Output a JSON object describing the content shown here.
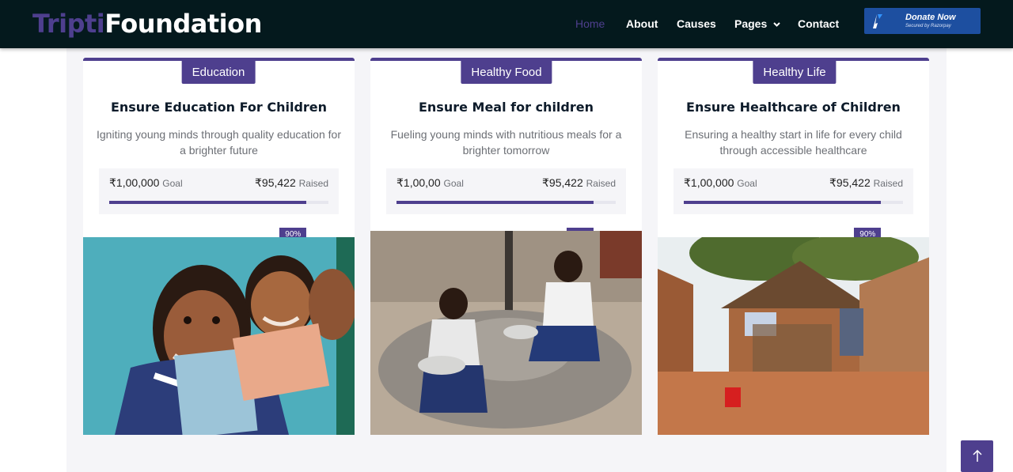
{
  "brand": {
    "part1": "Tripti",
    "part2": "Foundation"
  },
  "nav": {
    "items": [
      {
        "label": "Home",
        "active": true
      },
      {
        "label": "About",
        "active": false
      },
      {
        "label": "Causes",
        "active": false
      },
      {
        "label": "Pages",
        "active": false,
        "has_dropdown": true
      },
      {
        "label": "Contact",
        "active": false
      }
    ],
    "donate": {
      "label": "Donate Now",
      "sublabel": "Secured by Razorpay"
    }
  },
  "causes": [
    {
      "category": "Education",
      "title": "Ensure Education For Children",
      "description": "Igniting young minds through quality education for a brighter future",
      "goal_amount": "₹1,00,000",
      "goal_label": "Goal",
      "raised_amount": "₹95,422",
      "raised_label": "Raised",
      "progress_percent": 90,
      "progress_label": "90%",
      "photo": "children-smiling-holding-books-photo"
    },
    {
      "category": "Healthy Food",
      "title": "Ensure Meal for children",
      "description": "Fueling young minds with nutritious meals for a brighter tomorrow",
      "goal_amount": "₹1,00,00",
      "goal_label": "Goal",
      "raised_amount": "₹95,422",
      "raised_label": "Raised",
      "progress_percent": 90,
      "progress_label": "90%",
      "photo": "children-eating-meals-photo"
    },
    {
      "category": "Healthy Life",
      "title": "Ensure Healthcare of Children",
      "description": "Ensuring a healthy start in life for every child through accessible healthcare",
      "goal_amount": "₹1,00,000",
      "goal_label": "Goal",
      "raised_amount": "₹95,422",
      "raised_label": "Raised",
      "progress_percent": 90,
      "progress_label": "90%",
      "photo": "village-mud-houses-photo"
    }
  ],
  "colors": {
    "accent": "#4e3f8e",
    "navbar_bg": "#04191d",
    "donate_bg": "#1d4fa0",
    "section_bg": "#f5f5f8"
  },
  "icons": {
    "back_to_top": "arrow-up-icon",
    "dropdown": "chevron-down-icon",
    "razorpay": "razorpay-logo-icon"
  }
}
